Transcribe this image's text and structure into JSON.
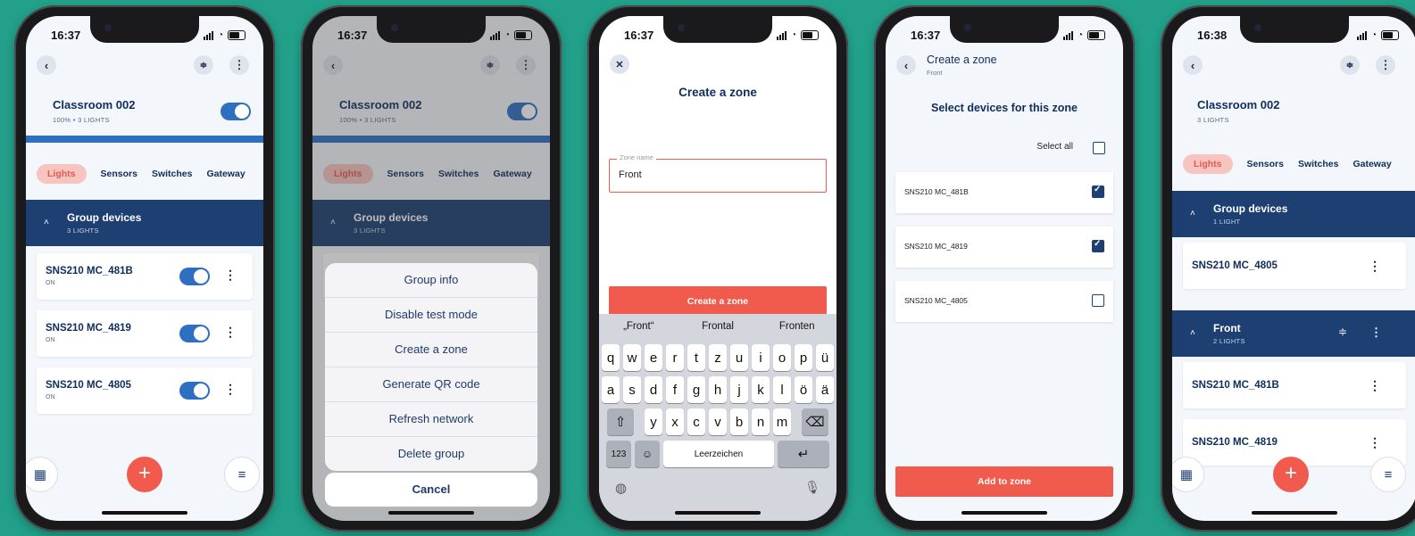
{
  "phones": [
    {
      "time": "16:37",
      "room_title": "Classroom 002",
      "room_sub": "100% • 3 LIGHTS",
      "tabs": [
        "Lights",
        "Sensors",
        "Switches",
        "Gateway"
      ],
      "group": {
        "title": "Group devices",
        "sub": "3 LIGHTS"
      },
      "devices": [
        {
          "name": "SNS210 MC_481B",
          "state": "ON"
        },
        {
          "name": "SNS210 MC_4819",
          "state": "ON"
        },
        {
          "name": "SNS210 MC_4805",
          "state": "ON"
        }
      ]
    },
    {
      "time": "16:37",
      "room_title": "Classroom 002",
      "room_sub": "100% • 3 LIGHTS",
      "tabs": [
        "Lights",
        "Sensors",
        "Switches",
        "Gateway"
      ],
      "group": {
        "title": "Group devices",
        "sub": "3 LIGHTS"
      },
      "menu": [
        "Group info",
        "Disable test mode",
        "Create a zone",
        "Generate QR code",
        "Refresh network",
        "Delete group"
      ],
      "cancel": "Cancel"
    },
    {
      "time": "16:37",
      "title": "Create a zone",
      "field_label": "Zone name",
      "field_value": "Front",
      "button": "Create a zone",
      "suggestions": [
        "„Front“",
        "Frontal",
        "Fronten"
      ],
      "keys_row1": [
        "q",
        "w",
        "e",
        "r",
        "t",
        "z",
        "u",
        "i",
        "o",
        "p",
        "ü"
      ],
      "keys_row2": [
        "a",
        "s",
        "d",
        "f",
        "g",
        "h",
        "j",
        "k",
        "l",
        "ö",
        "ä"
      ],
      "keys_row3": [
        "y",
        "x",
        "c",
        "v",
        "b",
        "n",
        "m"
      ],
      "num_key": "123",
      "space": "Leerzeichen"
    },
    {
      "time": "16:37",
      "header_title": "Create a zone",
      "header_sub": "Front",
      "heading": "Select devices for this zone",
      "select_all": "Select all",
      "devices": [
        {
          "name": "SNS210 MC_481B",
          "checked": true
        },
        {
          "name": "SNS210 MC_4819",
          "checked": true
        },
        {
          "name": "SNS210 MC_4805",
          "checked": false
        }
      ],
      "button": "Add to zone"
    },
    {
      "time": "16:38",
      "room_title": "Classroom 002",
      "room_sub": "3 LIGHTS",
      "tabs": [
        "Lights",
        "Sensors",
        "Switches",
        "Gateway"
      ],
      "group": {
        "title": "Group devices",
        "sub": "1 LIGHT"
      },
      "group_devices": [
        "SNS210 MC_4805"
      ],
      "zone": {
        "title": "Front",
        "sub": "2 LIGHTS"
      },
      "zone_devices": [
        "SNS210 MC_481B",
        "SNS210 MC_4819"
      ]
    }
  ],
  "colors": {
    "background": "#22a08a",
    "accent": "#f15b4d",
    "navy": "#1e3f72",
    "toggle": "#2e6fc2"
  },
  "icons": {
    "back": "chevron-left-icon",
    "filter": "sliders-icon",
    "more": "more-vertical-icon",
    "close": "close-icon",
    "add": "plus-icon",
    "building": "building-icon",
    "menu": "hamburger-icon"
  }
}
